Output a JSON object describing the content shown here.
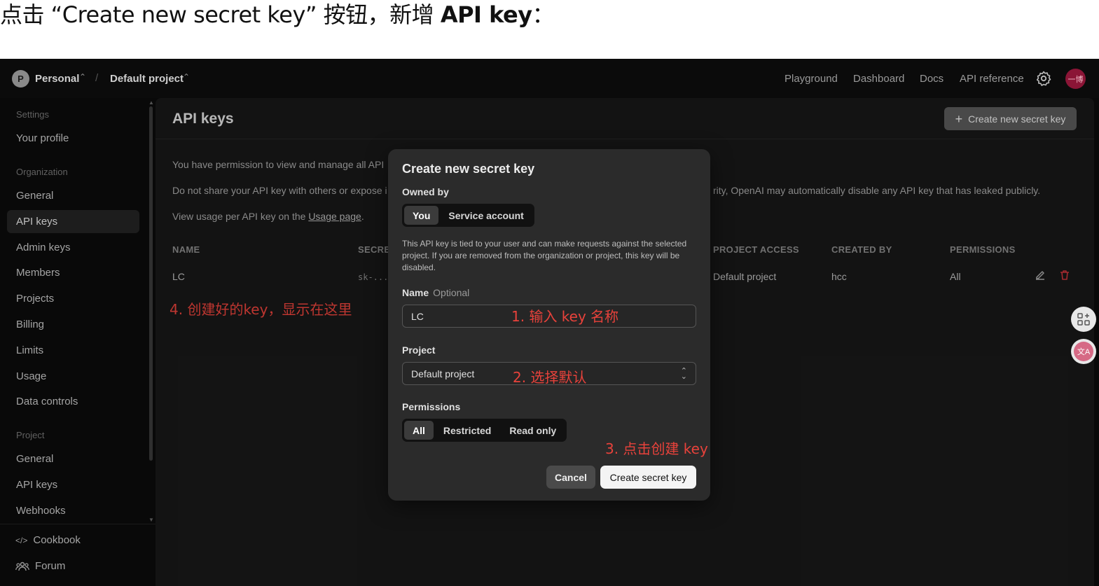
{
  "caption": {
    "prefix": "点击 “Create new secret key” 按钮，新增 ",
    "bold": "API key",
    "suffix": "："
  },
  "topnav": {
    "org_initial": "P",
    "org_name": "Personal",
    "project_name": "Default project",
    "links": [
      "Playground",
      "Dashboard",
      "Docs",
      "API reference"
    ],
    "user_avatar_text": "一博"
  },
  "sidebar": {
    "settings_header": "Settings",
    "your_profile": "Your profile",
    "org_header": "Organization",
    "org_items": [
      "General",
      "API keys",
      "Admin keys",
      "Members",
      "Projects",
      "Billing",
      "Limits",
      "Usage",
      "Data controls"
    ],
    "project_header": "Project",
    "project_items": [
      "General",
      "API keys",
      "Webhooks"
    ],
    "footer": [
      "Cookbook",
      "Forum"
    ]
  },
  "main": {
    "title": "API keys",
    "create_button": "Create new secret key",
    "para1": "You have permission to view and manage all API",
    "para2_left": "Do not share your API key with others or expose i",
    "para2_right": "rity, OpenAI may automatically disable any API key that has leaked publicly.",
    "para3_prefix": "View usage per API key on the ",
    "para3_link": "Usage page",
    "para3_suffix": ".",
    "columns": [
      "NAME",
      "SECRE",
      "PROJECT ACCESS",
      "CREATED BY",
      "PERMISSIONS"
    ],
    "row": {
      "name": "LC",
      "secret": "sk-...",
      "project": "Default project",
      "created_by": "hcc",
      "permissions": "All"
    }
  },
  "annotations": {
    "a1": "1. 输入 key 名称",
    "a2": "2. 选择默认",
    "a3": "3. 点击创建 key",
    "a4": "4. 创建好的key，显示在这里"
  },
  "modal": {
    "title": "Create new secret key",
    "owned_by_label": "Owned by",
    "owned_options": [
      "You",
      "Service account"
    ],
    "description": "This API key is tied to your user and can make requests against the selected project. If you are removed from the organization or project, this key will be disabled.",
    "name_label": "Name",
    "name_optional": "Optional",
    "name_value": "LC",
    "project_label": "Project",
    "project_value": "Default project",
    "permissions_label": "Permissions",
    "permission_options": [
      "All",
      "Restricted",
      "Read only"
    ],
    "cancel": "Cancel",
    "create": "Create secret key"
  },
  "colors": {
    "annotation": "#e8423b",
    "user_avatar": "#8b1536",
    "delete_icon": "#c9343a"
  }
}
